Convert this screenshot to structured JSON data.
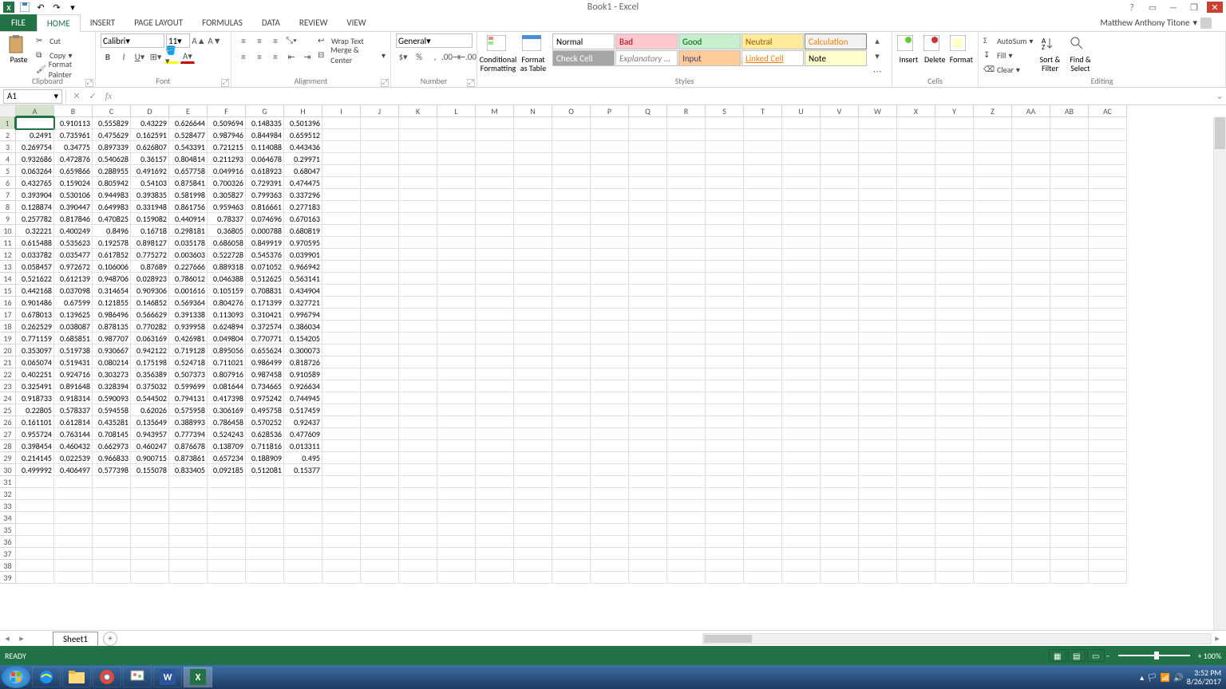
{
  "title": "Book1 - Excel",
  "user": "Matthew Anthony Titone",
  "tabs": {
    "file": "FILE",
    "home": "HOME",
    "insert": "INSERT",
    "pagelayout": "PAGE LAYOUT",
    "formulas": "FORMULAS",
    "data": "DATA",
    "review": "REVIEW",
    "view": "VIEW"
  },
  "clipboard": {
    "paste": "Paste",
    "cut": "Cut",
    "copy": "Copy",
    "fmt": "Format Painter",
    "label": "Clipboard"
  },
  "font": {
    "name": "Calibri",
    "size": "11",
    "label": "Font"
  },
  "alignment": {
    "wrap": "Wrap Text",
    "merge": "Merge & Center",
    "label": "Alignment"
  },
  "number": {
    "format": "General",
    "label": "Number"
  },
  "styles": {
    "cond": "Conditional Formatting",
    "fmtTable": "Format as Table",
    "normal": "Normal",
    "bad": "Bad",
    "good": "Good",
    "neutral": "Neutral",
    "calc": "Calculation",
    "check": "Check Cell",
    "explan": "Explanatory ...",
    "input": "Input",
    "linked": "Linked Cell",
    "note": "Note",
    "label": "Styles"
  },
  "cells": {
    "insert": "Insert",
    "delete": "Delete",
    "format": "Format",
    "label": "Cells"
  },
  "editing": {
    "autosum": "AutoSum",
    "fill": "Fill",
    "clear": "Clear",
    "sort": "Sort & Filter",
    "find": "Find & Select",
    "label": "Editing"
  },
  "namebox": "A1",
  "columns": [
    "A",
    "B",
    "C",
    "D",
    "E",
    "F",
    "G",
    "H",
    "I",
    "J",
    "K",
    "L",
    "M",
    "N",
    "O",
    "P",
    "Q",
    "R",
    "S",
    "T",
    "U",
    "V",
    "W",
    "X",
    "Y",
    "Z",
    "AA",
    "AB",
    "AC"
  ],
  "rows": 39,
  "data": [
    [
      "",
      "0.910113",
      "0.555829",
      "0.43229",
      "0.626644",
      "0.509694",
      "0.148335",
      "0.501396"
    ],
    [
      "0.2491",
      "0.735961",
      "0.475629",
      "0.162591",
      "0.528477",
      "0.987946",
      "0.844984",
      "0.659512"
    ],
    [
      "0.269754",
      "0.34775",
      "0.897339",
      "0.626807",
      "0.543391",
      "0.721215",
      "0.114088",
      "0.443436"
    ],
    [
      "0.932686",
      "0.472876",
      "0.540628",
      "0.36157",
      "0.804814",
      "0.211293",
      "0.064678",
      "0.29971"
    ],
    [
      "0.063264",
      "0.659866",
      "0.288955",
      "0.491692",
      "0.657758",
      "0.049916",
      "0.618923",
      "0.68047"
    ],
    [
      "0.432765",
      "0.159024",
      "0.805942",
      "0.54103",
      "0.875841",
      "0.700326",
      "0.729391",
      "0.474475"
    ],
    [
      "0.393904",
      "0.530106",
      "0.944983",
      "0.393835",
      "0.581998",
      "0.305827",
      "0.799363",
      "0.337296"
    ],
    [
      "0.128874",
      "0.390447",
      "0.649983",
      "0.331948",
      "0.861756",
      "0.959463",
      "0.816661",
      "0.277183"
    ],
    [
      "0.257782",
      "0.817846",
      "0.470825",
      "0.159082",
      "0.440914",
      "0.78337",
      "0.074696",
      "0.670163"
    ],
    [
      "0.32221",
      "0.400249",
      "0.8496",
      "0.16718",
      "0.298181",
      "0.36805",
      "0.000788",
      "0.680819"
    ],
    [
      "0.615488",
      "0.535623",
      "0.192578",
      "0.898127",
      "0.035178",
      "0.686058",
      "0.849919",
      "0.970595"
    ],
    [
      "0.033782",
      "0.035477",
      "0.617852",
      "0.775272",
      "0.003603",
      "0.522728",
      "0.545376",
      "0.039901"
    ],
    [
      "0.058457",
      "0.972672",
      "0.106006",
      "0.87689",
      "0.227666",
      "0.889318",
      "0.071052",
      "0.966942"
    ],
    [
      "0.521622",
      "0.612139",
      "0.948706",
      "0.028923",
      "0.786012",
      "0.046388",
      "0.512625",
      "0.563141"
    ],
    [
      "0.442168",
      "0.037098",
      "0.314654",
      "0.909306",
      "0.001616",
      "0.105159",
      "0.708831",
      "0.434904"
    ],
    [
      "0.901486",
      "0.67599",
      "0.121855",
      "0.146852",
      "0.569364",
      "0.804276",
      "0.171399",
      "0.327721"
    ],
    [
      "0.678013",
      "0.139625",
      "0.986496",
      "0.566629",
      "0.391338",
      "0.113093",
      "0.310421",
      "0.996794"
    ],
    [
      "0.262529",
      "0.038087",
      "0.878135",
      "0.770282",
      "0.939958",
      "0.624894",
      "0.372574",
      "0.386034"
    ],
    [
      "0.771159",
      "0.685851",
      "0.987707",
      "0.063169",
      "0.426981",
      "0.049804",
      "0.770771",
      "0.154205"
    ],
    [
      "0.353097",
      "0.519738",
      "0.930667",
      "0.942122",
      "0.719128",
      "0.895056",
      "0.655624",
      "0.300073"
    ],
    [
      "0.065074",
      "0.519431",
      "0.080214",
      "0.175198",
      "0.524718",
      "0.711021",
      "0.986499",
      "0.818726"
    ],
    [
      "0.402251",
      "0.924716",
      "0.303273",
      "0.356389",
      "0.507373",
      "0.807916",
      "0.987458",
      "0.910589"
    ],
    [
      "0.325491",
      "0.891648",
      "0.328394",
      "0.375032",
      "0.599699",
      "0.081644",
      "0.734665",
      "0.926634"
    ],
    [
      "0.918733",
      "0.918314",
      "0.590093",
      "0.544502",
      "0.794131",
      "0.417398",
      "0.975242",
      "0.744945"
    ],
    [
      "0.22805",
      "0.578337",
      "0.594558",
      "0.62026",
      "0.575958",
      "0.306169",
      "0.495758",
      "0.517459"
    ],
    [
      "0.161101",
      "0.612814",
      "0.435281",
      "0.135649",
      "0.388993",
      "0.786458",
      "0.570252",
      "0.92437"
    ],
    [
      "0.955724",
      "0.763144",
      "0.708145",
      "0.943957",
      "0.777394",
      "0.524243",
      "0.628536",
      "0.477609"
    ],
    [
      "0.398454",
      "0.460432",
      "0.662973",
      "0.460247",
      "0.876678",
      "0.138709",
      "0.711816",
      "0.013311"
    ],
    [
      "0.214145",
      "0.022539",
      "0.966833",
      "0.900715",
      "0.873861",
      "0.657234",
      "0.188909",
      "0.495"
    ],
    [
      "0.499992",
      "0.406497",
      "0.577398",
      "0.155078",
      "0.833405",
      "0.092185",
      "0.512081",
      "0.15377"
    ]
  ],
  "sheet": "Sheet1",
  "status": "READY",
  "zoom": "100%",
  "clock": {
    "time": "3:52 PM",
    "date": "8/26/2017"
  }
}
